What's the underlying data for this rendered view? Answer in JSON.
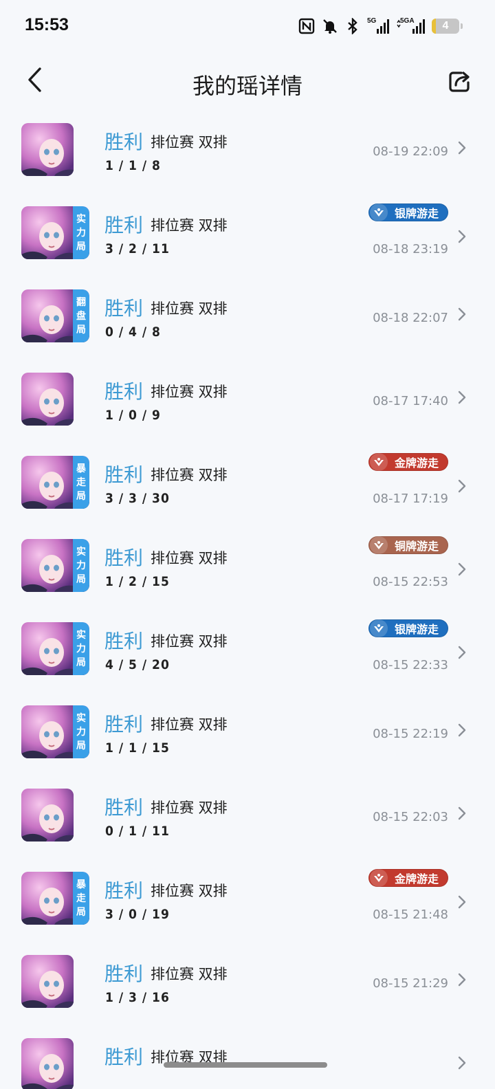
{
  "status_bar": {
    "time": "15:53",
    "net1": "5G",
    "net2": "5GA",
    "battery": "4"
  },
  "header": {
    "title": "我的瑶详情"
  },
  "colors": {
    "win": "#3d9ad3",
    "tag": "#3aa0e8",
    "silver_badge": "#1f6fbf",
    "gold_badge": "#c23a2e",
    "bronze_badge": "#a9654f"
  },
  "matches": [
    {
      "result": "胜利",
      "mode": "排位赛 双排",
      "kda": "1 / 1 / 8",
      "time": "08-19 22:09",
      "tag": [],
      "badge": null,
      "badge_type": null
    },
    {
      "result": "胜利",
      "mode": "排位赛 双排",
      "kda": "3 / 2 / 11",
      "time": "08-18 23:19",
      "tag": [
        "实",
        "力",
        "局"
      ],
      "badge": "银牌游走",
      "badge_type": "silver"
    },
    {
      "result": "胜利",
      "mode": "排位赛 双排",
      "kda": "0 / 4 / 8",
      "time": "08-18 22:07",
      "tag": [
        "翻",
        "盘",
        "局"
      ],
      "badge": null,
      "badge_type": null
    },
    {
      "result": "胜利",
      "mode": "排位赛 双排",
      "kda": "1 / 0 / 9",
      "time": "08-17 17:40",
      "tag": [],
      "badge": null,
      "badge_type": null
    },
    {
      "result": "胜利",
      "mode": "排位赛 双排",
      "kda": "3 / 3 / 30",
      "time": "08-17 17:19",
      "tag": [
        "暴",
        "走",
        "局"
      ],
      "badge": "金牌游走",
      "badge_type": "gold"
    },
    {
      "result": "胜利",
      "mode": "排位赛 双排",
      "kda": "1 / 2 / 15",
      "time": "08-15 22:53",
      "tag": [
        "实",
        "力",
        "局"
      ],
      "badge": "铜牌游走",
      "badge_type": "bronze"
    },
    {
      "result": "胜利",
      "mode": "排位赛 双排",
      "kda": "4 / 5 / 20",
      "time": "08-15 22:33",
      "tag": [
        "实",
        "力",
        "局"
      ],
      "badge": "银牌游走",
      "badge_type": "silver"
    },
    {
      "result": "胜利",
      "mode": "排位赛 双排",
      "kda": "1 / 1 / 15",
      "time": "08-15 22:19",
      "tag": [
        "实",
        "力",
        "局"
      ],
      "badge": null,
      "badge_type": null
    },
    {
      "result": "胜利",
      "mode": "排位赛 双排",
      "kda": "0 / 1 / 11",
      "time": "08-15 22:03",
      "tag": [],
      "badge": null,
      "badge_type": null
    },
    {
      "result": "胜利",
      "mode": "排位赛 双排",
      "kda": "3 / 0 / 19",
      "time": "08-15 21:48",
      "tag": [
        "暴",
        "走",
        "局"
      ],
      "badge": "金牌游走",
      "badge_type": "gold"
    },
    {
      "result": "胜利",
      "mode": "排位赛 双排",
      "kda": "1 / 3 / 16",
      "time": "08-15 21:29",
      "tag": [],
      "badge": null,
      "badge_type": null
    },
    {
      "result": "胜利",
      "mode": "排位赛 双排",
      "kda": "",
      "time": "",
      "tag": [],
      "badge": null,
      "badge_type": null
    }
  ]
}
